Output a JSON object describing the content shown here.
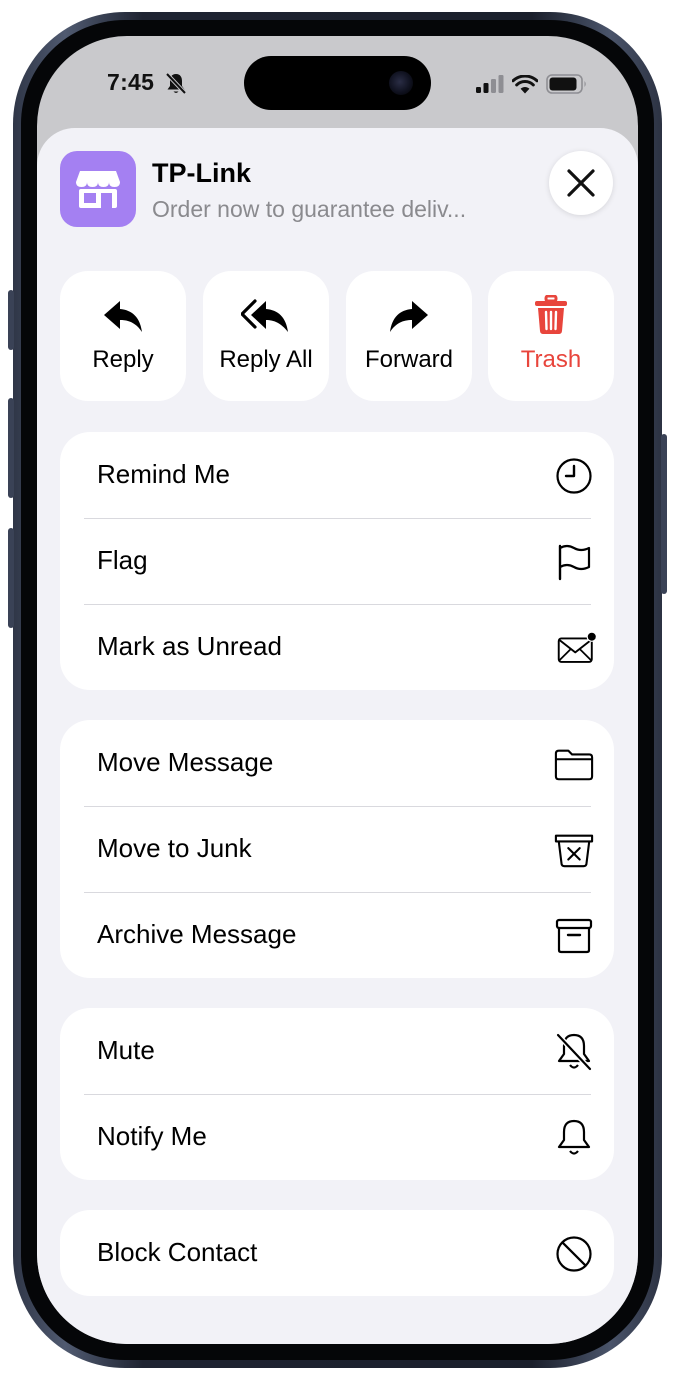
{
  "status_bar": {
    "time": "7:45"
  },
  "header": {
    "sender": "TP-Link",
    "subject": "Order now to guarantee deliv..."
  },
  "actions": [
    {
      "label": "Reply",
      "icon": "reply-icon"
    },
    {
      "label": "Reply All",
      "icon": "reply-all-icon"
    },
    {
      "label": "Forward",
      "icon": "forward-icon"
    },
    {
      "label": "Trash",
      "icon": "trash-icon",
      "color": "#e8453c"
    }
  ],
  "groups": [
    {
      "rows": [
        {
          "label": "Remind Me",
          "icon": "clock-icon"
        },
        {
          "label": "Flag",
          "icon": "flag-icon"
        },
        {
          "label": "Mark as Unread",
          "icon": "envelope-unread-icon"
        }
      ]
    },
    {
      "rows": [
        {
          "label": "Move Message",
          "icon": "folder-icon"
        },
        {
          "label": "Move to Junk",
          "icon": "junk-bin-icon"
        },
        {
          "label": "Archive Message",
          "icon": "archive-box-icon"
        }
      ]
    },
    {
      "rows": [
        {
          "label": "Mute",
          "icon": "bell-slash-icon"
        },
        {
          "label": "Notify Me",
          "icon": "bell-icon"
        }
      ]
    },
    {
      "rows": [
        {
          "label": "Block Contact",
          "icon": "block-icon"
        }
      ]
    }
  ],
  "colors": {
    "accent_app_icon": "#a480f2",
    "destructive": "#e8453c",
    "sheet_background": "#f2f2f7"
  }
}
